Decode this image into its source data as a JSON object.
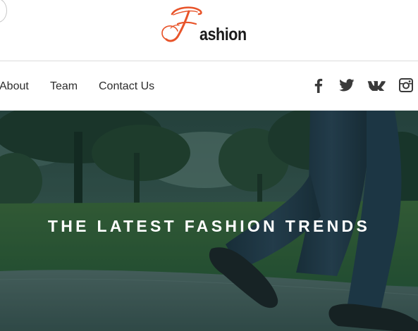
{
  "brand": {
    "logo_initial": "F",
    "logo_rest": "ashion",
    "logo_text": "Fashion",
    "accent_color": "#e8542a"
  },
  "nav": {
    "items": [
      {
        "label": "About"
      },
      {
        "label": "Team"
      },
      {
        "label": "Contact Us"
      }
    ]
  },
  "social": [
    {
      "icon": "facebook-icon"
    },
    {
      "icon": "twitter-icon"
    },
    {
      "icon": "vk-icon"
    },
    {
      "icon": "instagram-icon"
    }
  ],
  "hero": {
    "title": "THE LATEST FASHION TRENDS"
  }
}
